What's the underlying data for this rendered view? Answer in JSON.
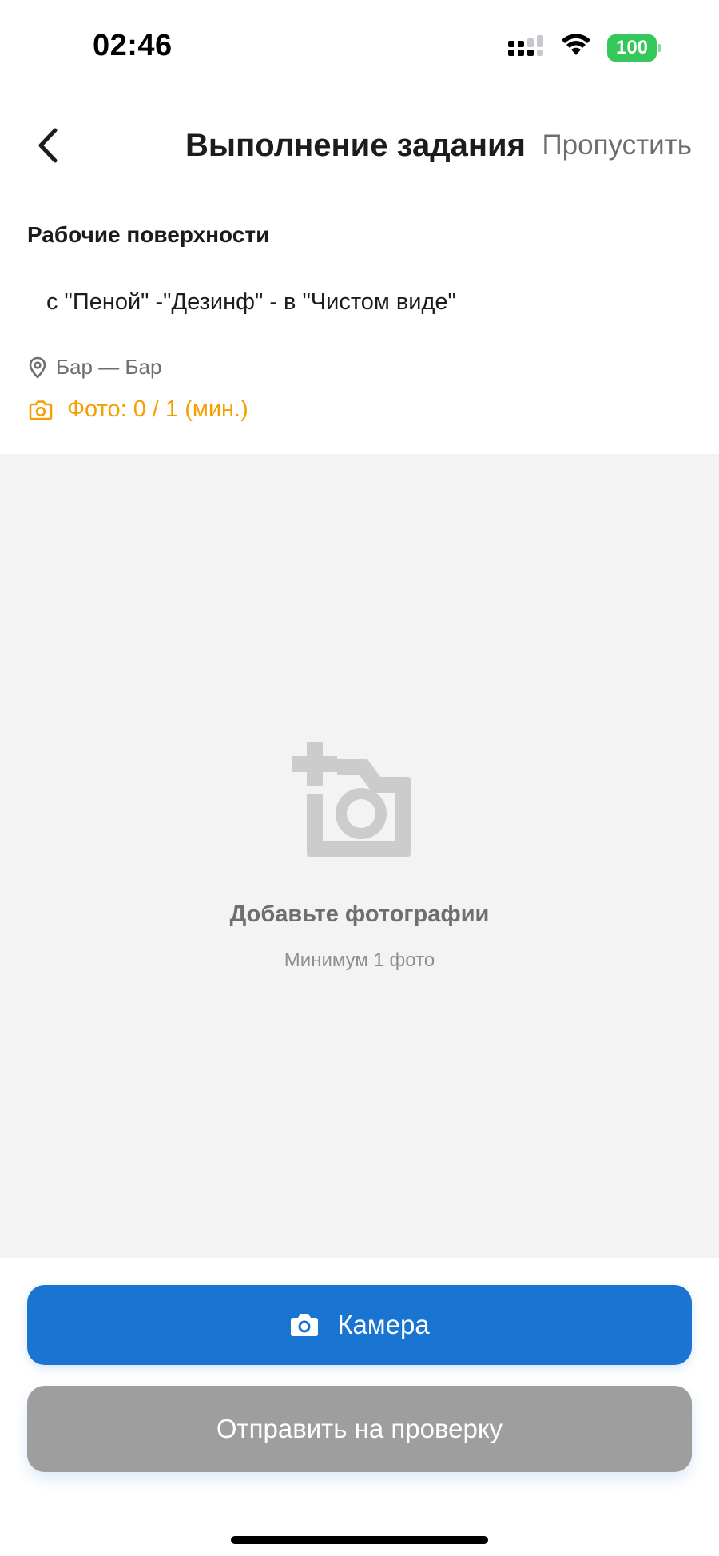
{
  "status_bar": {
    "time": "02:46",
    "battery": "100",
    "icons": [
      "cellular-signal-icon",
      "wifi-icon",
      "battery-icon"
    ]
  },
  "nav": {
    "title": "Выполнение задания",
    "skip_label": "Пропустить",
    "back_icon": "chevron-left-icon"
  },
  "task": {
    "category": "Рабочие поверхности",
    "description": "с \"Пеной\" -\"Дезинф\" - в \"Чистом виде\"",
    "location": "Бар — Бар",
    "photo_count": "Фото: 0 / 1 (мин.)"
  },
  "photo_area": {
    "title": "Добавьте фотографии",
    "subtitle": "Минимум 1 фото",
    "icon": "add-photo-icon"
  },
  "actions": {
    "camera_label": "Камера",
    "submit_label": "Отправить на проверку"
  },
  "colors": {
    "primary": "#1a74d2",
    "warning": "#f5a000",
    "disabled": "#9e9e9e",
    "battery": "#34c759"
  }
}
